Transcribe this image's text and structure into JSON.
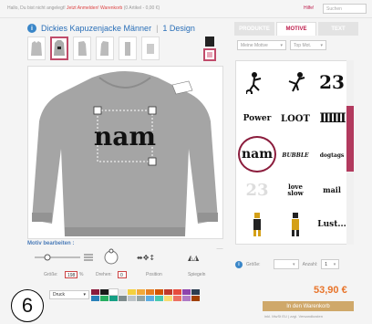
{
  "topbar": {
    "message": "Hallo, Du bist nicht angelegt!",
    "message_link": "Jetzt Anmelden!",
    "cart_link": "Warenkorb",
    "cart_info": "(0 Artikel - 0,00 €)",
    "help": "Hilfe!",
    "search_placeholder": "Suchen"
  },
  "product": {
    "title": "Dickies Kapuzenjacke Männer",
    "design_count": "1 Design"
  },
  "tabs": [
    {
      "label": "PRODUKTE"
    },
    {
      "label": "MOTIVE"
    },
    {
      "label": "TEXT"
    }
  ],
  "filters": {
    "category": "Meine Motive",
    "sort": "Top Mot."
  },
  "gallery": {
    "rows": [
      [
        "rider",
        "dancer",
        "23"
      ],
      [
        "Power",
        "LOOT",
        "IIIIII"
      ],
      [
        "nam",
        "BUBBLE",
        "dogtags"
      ],
      [
        "23",
        "love slow",
        "mail"
      ],
      [
        "figure",
        "figure",
        "Lust..."
      ]
    ]
  },
  "editor": {
    "heading": "Motiv bearbeiten :",
    "size_label": "Größe:",
    "size_value": "198",
    "size_unit": "%",
    "rotate_label": "Drehen:",
    "rotate_value": "0",
    "position_label": "Position",
    "mirror_label": "Spiegeln",
    "print_label": "Druck"
  },
  "order": {
    "size_label": "Größe:",
    "qty_label": "Anzahl:",
    "qty_value": "1",
    "price": "53,90 €",
    "cart_button": "In den Warenkorb",
    "tax_note": "inkl. MwSt EU | zzgl. Versandkosten"
  },
  "callout": "6",
  "colors": {
    "accent": "#bd1a4a",
    "blue": "#2a6fb8",
    "price": "#e8742a",
    "selection": "#8b1c3c"
  },
  "palette": [
    "#8b1c3c",
    "#1a1a1a",
    "#ffffff",
    "#e8e8e8",
    "#f4d03f",
    "#f2a93b",
    "#e67e22",
    "#d35400",
    "#c0392b",
    "#e74c3c",
    "#8e44ad",
    "#2c3e50",
    "#2980b9",
    "#27ae60",
    "#16a085",
    "#7f8c8d",
    "#bdc3c7",
    "#95a5a6",
    "#5dade2",
    "#48c9b0",
    "#f7dc6f",
    "#ec7063",
    "#af7ac5",
    "#a04000"
  ]
}
